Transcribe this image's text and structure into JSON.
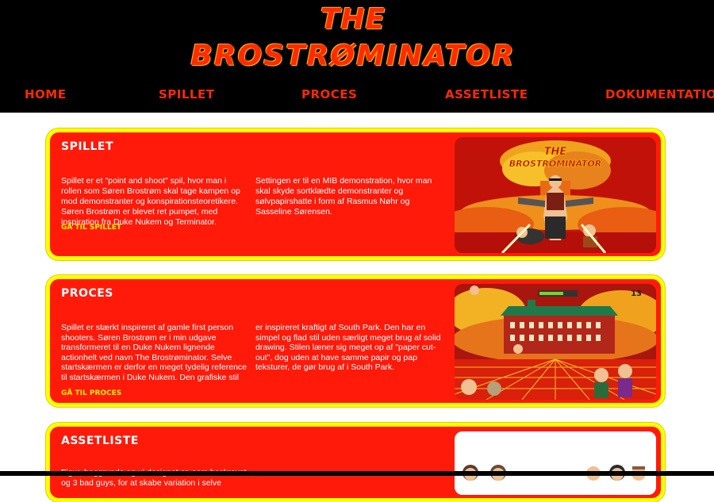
{
  "logo": {
    "line1": "THE",
    "line2": "BROSTRØMINATOR"
  },
  "nav": [
    "HOME",
    "SPILLET",
    "PROCES",
    "ASSETLISTE",
    "DOKUMENTATION"
  ],
  "cards": [
    {
      "title": "SPILLET",
      "text": "Spillet er et \"point and shoot\" spil, hvor man i rollen som Søren Brostrøm skal tage kampen op mod demonstranter og konspirationsteoretikere. Søren Brostrøm er blevet ret pumpet, med inspiration fra Duke Nukem og Terminator. Settingen er til en MIB demonstration, hvor man skal skyde sortklædte demonstranter og sølvpapirshatte i form af Rasmus Nøhr og Sasseline Sørensen.",
      "link": "GÅ TIL SPILLET",
      "image": {
        "title_line1": "THE",
        "title_line2": "BROSTRØMINATOR"
      }
    },
    {
      "title": "PROCES",
      "text": "Spillet er stærkt inspireret af gamle first person shooters. Søren Brostrøm er i min udgave transformeret til en Duke Nukem lignende actionhelt ved navn The Brostrøminator. Selve startskærmen er derfor en meget tydelig reference til startskærmen i Duke Nukem. Den grafiske stil er inspireret kraftigt af South Park. Den har en simpel og flad stil uden særligt meget brug af solid drawing. Stilen læner sig meget op af \"paper cut-out\", dog uden at have samme papir og pap teksturer, de gør brug af i South Park.",
      "link": "GÅ TIL PROCES",
      "image": {
        "counter": "13"
      }
    },
    {
      "title": "ASSETLISTE",
      "text": "Figur, baggrunde og ui designet er, som beskrevet og 3 bad guys, for at skabe variation i selve",
      "link": "",
      "image": {}
    }
  ],
  "colors": {
    "header_bg": "#000000",
    "card_red": "#ff1a0a",
    "card_border": "#ffff00",
    "accent": "#ff2a00"
  }
}
